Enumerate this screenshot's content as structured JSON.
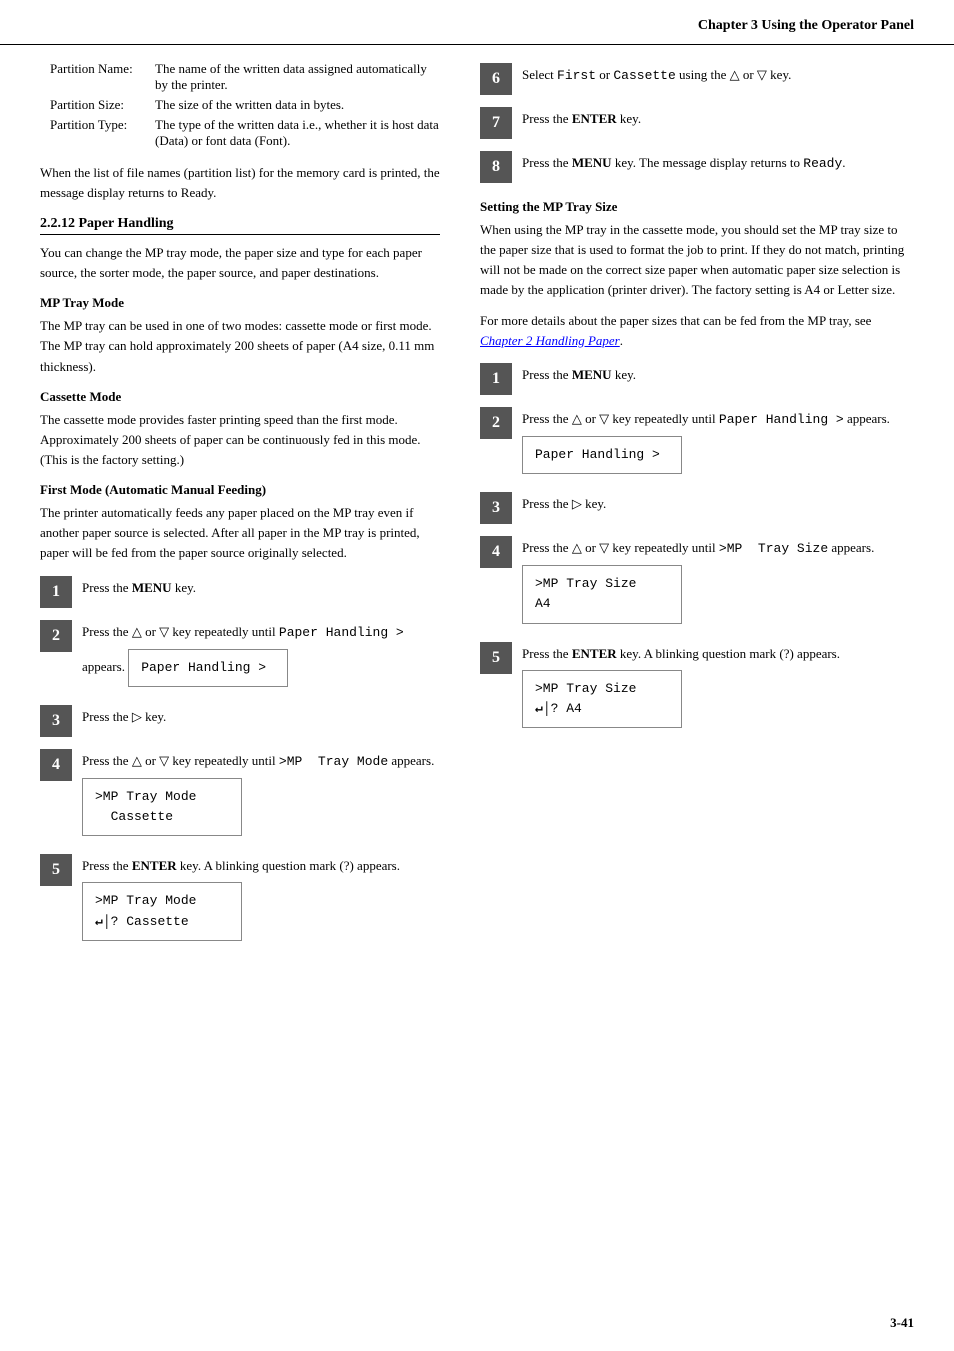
{
  "header": {
    "chapter": "Chapter 3  Using the Operator Panel"
  },
  "left_col": {
    "partition_table": {
      "rows": [
        {
          "label": "Partition Name:",
          "value": "The name of the written data assigned automatically by the printer."
        },
        {
          "label": "Partition Size:",
          "value": "The size of the written data in bytes."
        },
        {
          "label": "Partition Type:",
          "value": "The type of the written data i.e., whether it is host data (Data) or font data (Font)."
        }
      ]
    },
    "when_list_text": "When the list of file names (partition list) for the memory card is printed, the message display returns to Ready.",
    "section": {
      "title": "2.2.12 Paper Handling",
      "body": "You can change the MP tray mode, the paper size and type for each paper source, the sorter mode, the paper source, and paper destinations."
    },
    "mp_tray": {
      "title": "MP Tray Mode",
      "body": "The MP tray can be used in one of two modes: cassette mode or first mode. The MP tray can hold approximately 200 sheets of paper (A4 size, 0.11 mm thickness)."
    },
    "cassette": {
      "title": "Cassette Mode",
      "body": "The cassette mode provides faster printing speed than the first mode. Approximately 200 sheets of paper can be continuously fed in this mode. (This is the factory setting.)"
    },
    "first_mode": {
      "title": "First Mode (Automatic Manual Feeding)",
      "body": "The printer automatically feeds any paper placed on the MP tray even if another paper source is selected. After all paper in the MP tray is printed, paper will be fed from the paper source originally selected."
    },
    "steps": [
      {
        "num": "1",
        "text": "Press the <b>MENU</b> key."
      },
      {
        "num": "2",
        "text": "Press the △ or ▽ key repeatedly until <code>Paper Handling ></code> appears.",
        "lcd": {
          "lines": [
            "Paper Handling >"
          ],
          "cursor": false
        }
      },
      {
        "num": "3",
        "text": "Press the ▷ key."
      },
      {
        "num": "4",
        "text": "Press the △ or ▽ key repeatedly until <code>>MP  Tray Mode</code> appears.",
        "lcd": {
          "lines": [
            ">MP Tray Mode",
            "  Cassette"
          ],
          "cursor": false
        }
      },
      {
        "num": "5",
        "text": "Press the <b>ENTER</b> key. A blinking question mark (?) appears.",
        "lcd": {
          "lines": [
            ">MP Tray Mode",
            "? Cassette"
          ],
          "cursor": true
        }
      }
    ]
  },
  "right_col": {
    "steps_top": [
      {
        "num": "6",
        "text": "Select <code>First</code> or <code>Cassette</code> using the △ or ▽ key."
      },
      {
        "num": "7",
        "text": "Press the <b>ENTER</b> key."
      },
      {
        "num": "8",
        "text": "Press the <b>MENU</b> key. The message display returns to <code>Ready</code>."
      }
    ],
    "setting_mp": {
      "title": "Setting the MP Tray Size",
      "body1": "When using the MP tray in the cassette mode, you should set the MP tray size to the paper size that is used to format the job to print. If they do not match, printing will not be made on the correct size paper when automatic paper size selection is made by the application (printer driver). The factory setting is A4 or Letter size.",
      "body2": "For more details about the paper sizes that can be fed from the MP tray, see ",
      "link": "Chapter 2 Handling Paper",
      "body2_end": "."
    },
    "steps": [
      {
        "num": "1",
        "text": "Press the <b>MENU</b> key."
      },
      {
        "num": "2",
        "text": "Press the △ or ▽ key repeatedly until <code>Paper Handling ></code> appears.",
        "lcd": {
          "lines": [
            "Paper Handling >"
          ],
          "cursor": false
        }
      },
      {
        "num": "3",
        "text": "Press the ▷ key."
      },
      {
        "num": "4",
        "text": "Press the △ or ▽ key repeatedly until <code>>MP  Tray Size</code> appears.",
        "lcd": {
          "lines": [
            ">MP Tray Size",
            "A4"
          ],
          "cursor": false
        }
      },
      {
        "num": "5",
        "text": "Press the <b>ENTER</b> key. A blinking question mark (?) appears.",
        "lcd": {
          "lines": [
            ">MP Tray Size",
            "? A4"
          ],
          "cursor": true
        }
      }
    ]
  },
  "page_number": "3-41"
}
